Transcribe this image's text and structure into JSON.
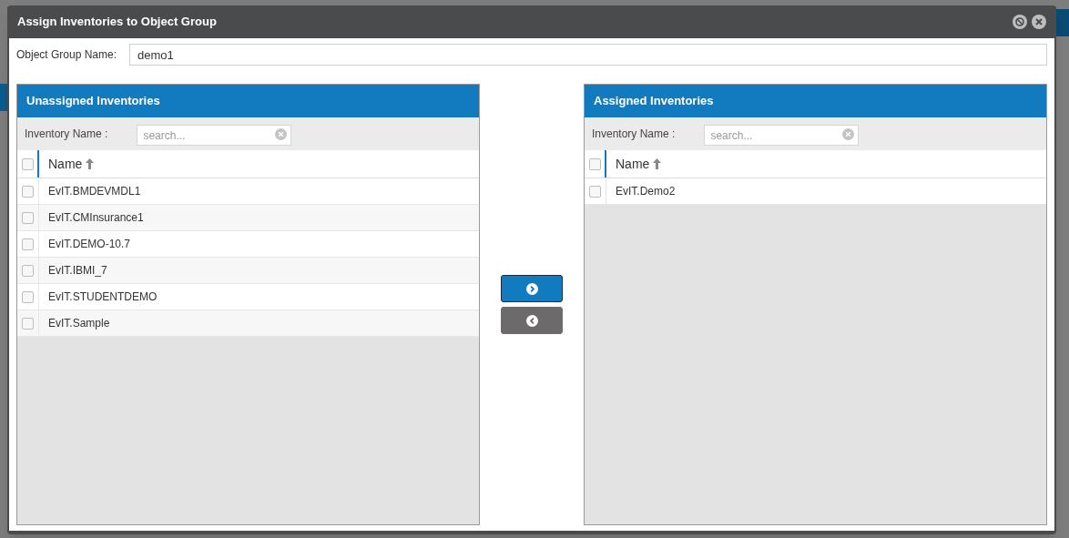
{
  "dialog": {
    "title": "Assign Inventories to Object Group"
  },
  "group_name": {
    "label": "Object Group Name:",
    "value": "demo1"
  },
  "panels": [
    {
      "title": "Unassigned Inventories",
      "filter_label": "Inventory Name :",
      "search_placeholder": "search...",
      "column": "Name",
      "select_all_checked": false,
      "rows": [
        {
          "name": "EvIT.BMDEVMDL1",
          "checked": false
        },
        {
          "name": "EvIT.CMInsurance1",
          "checked": false
        },
        {
          "name": "EvIT.DEMO-10.7",
          "checked": false
        },
        {
          "name": "EvIT.IBMI_7",
          "checked": false
        },
        {
          "name": "EvIT.STUDENTDEMO",
          "checked": false
        },
        {
          "name": "EvIT.Sample",
          "checked": false
        }
      ]
    },
    {
      "title": "Assigned Inventories",
      "filter_label": "Inventory Name :",
      "search_placeholder": "search...",
      "column": "Name",
      "select_all_checked": false,
      "rows": [
        {
          "name": "EvIT.Demo2",
          "checked": false
        }
      ]
    }
  ],
  "move_buttons": [
    {
      "kind": "assign",
      "disabled": false
    },
    {
      "kind": "unassign",
      "disabled": true
    }
  ]
}
